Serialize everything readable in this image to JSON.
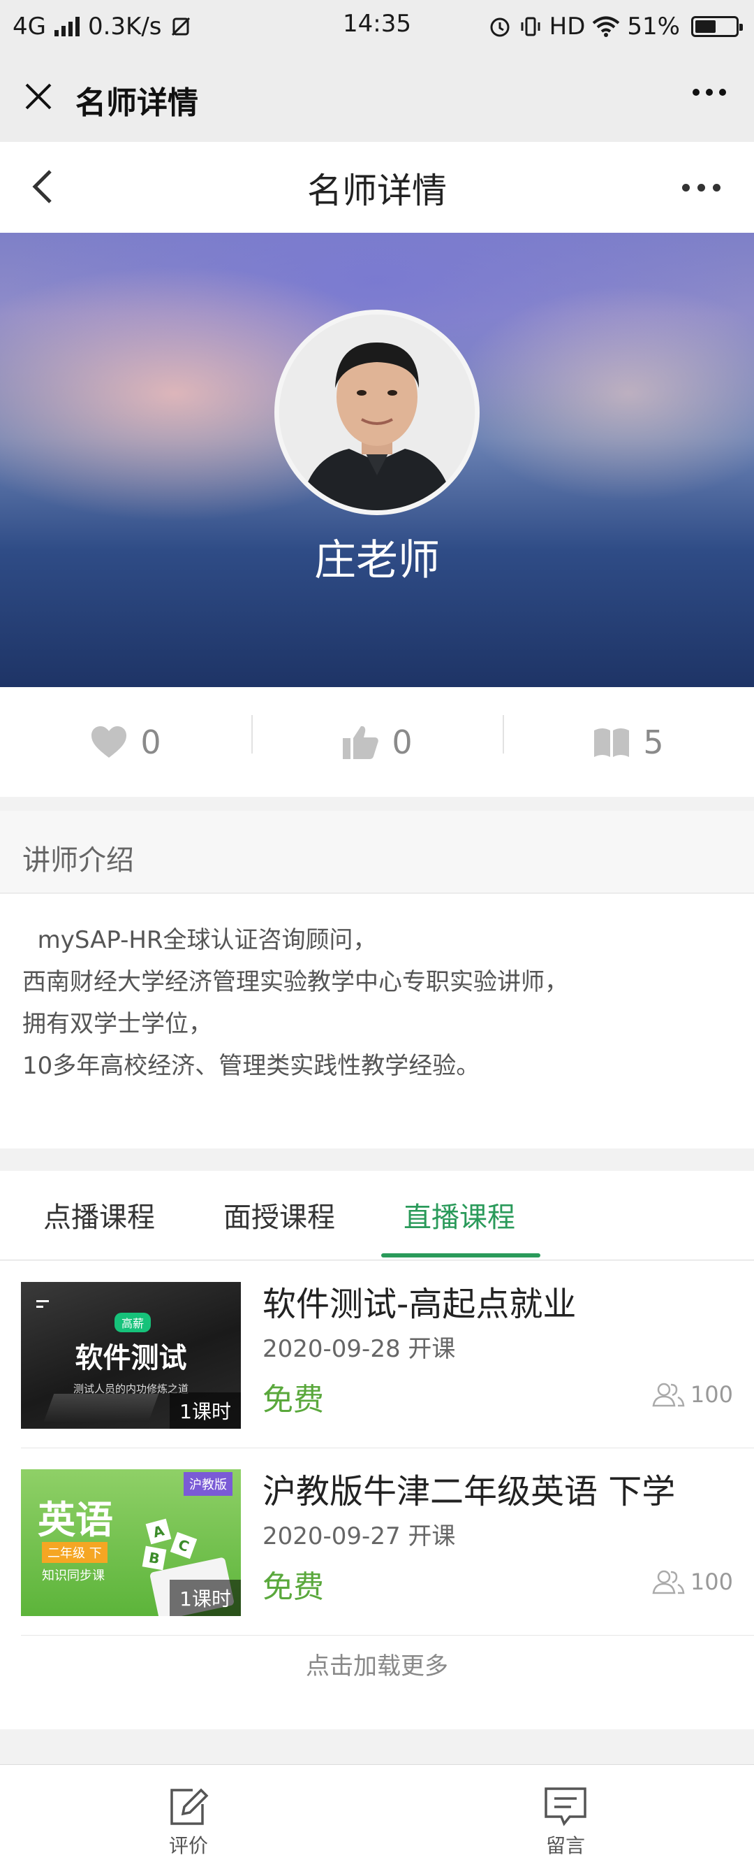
{
  "status_bar": {
    "network": "4G",
    "speed": "0.3K/s",
    "time": "14:35",
    "hd": "HD",
    "battery_text": "51%",
    "battery_level": 0.51
  },
  "wechat_bar": {
    "title": "名师详情"
  },
  "page_header": {
    "title": "名师详情"
  },
  "teacher": {
    "name": "庄老师"
  },
  "stats": {
    "favorites": "0",
    "likes": "0",
    "courses": "5"
  },
  "intro": {
    "heading": "讲师介绍",
    "lines": [
      "  mySAP-HR全球认证咨询顾问，",
      "西南财经大学经济管理实验教学中心专职实验讲师，",
      "拥有双学士学位，",
      "10多年高校经济、管理类实践性教学经验。"
    ]
  },
  "tabs": [
    {
      "label": "点播课程",
      "active": false
    },
    {
      "label": "面授课程",
      "active": false
    },
    {
      "label": "直播课程",
      "active": true
    }
  ],
  "courses": [
    {
      "title": "软件测试-高起点就业",
      "date": "2020-09-28 开课",
      "price": "免费",
      "members": "100",
      "lessons": "1课时",
      "thumb": {
        "tag": "高薪",
        "main": "软件测试",
        "sub": "测试人员的内功修炼之道"
      }
    },
    {
      "title": "沪教版牛津二年级英语 下学",
      "date": "2020-09-27 开课",
      "price": "免费",
      "members": "100",
      "lessons": "1课时",
      "thumb": {
        "corner": "沪教版",
        "main": "英语",
        "grade": "二年级 下",
        "sub": "知识同步课",
        "letters": [
          "A",
          "B",
          "C"
        ]
      }
    }
  ],
  "load_more": "点击加载更多",
  "bottom_bar": {
    "review": "评价",
    "message": "留言"
  },
  "colors": {
    "accent_green": "#2a9a5a",
    "price_green": "#5aa83c"
  }
}
